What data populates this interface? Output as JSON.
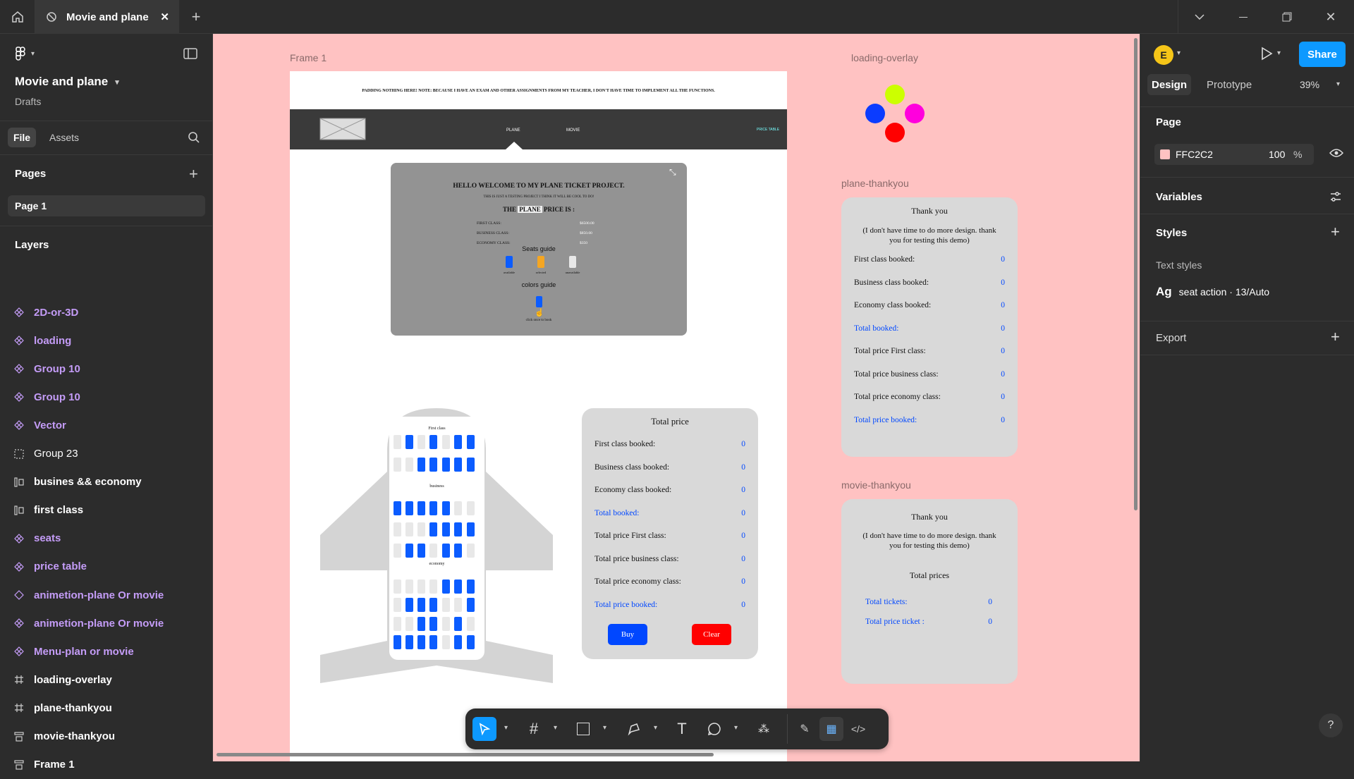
{
  "tab": {
    "title": "Movie and plane"
  },
  "file": {
    "name": "Movie and plane",
    "location": "Drafts",
    "tab_file": "File",
    "tab_assets": "Assets"
  },
  "pages": {
    "heading": "Pages",
    "items": [
      "Page 1"
    ]
  },
  "layers": {
    "heading": "Layers",
    "items": [
      {
        "label": "2D-or-3D",
        "icon": "component-icon",
        "style": "purple"
      },
      {
        "label": "loading",
        "icon": "component-icon",
        "style": "purple"
      },
      {
        "label": "Group 10",
        "icon": "component-icon",
        "style": "purple"
      },
      {
        "label": "Group 10",
        "icon": "component-icon",
        "style": "purple"
      },
      {
        "label": "Vector",
        "icon": "component-icon",
        "style": "purple"
      },
      {
        "label": "Group 23",
        "icon": "group-icon",
        "style": "normal"
      },
      {
        "label": "busines && economy",
        "icon": "autolayout-icon",
        "style": "white"
      },
      {
        "label": "first class",
        "icon": "autolayout-icon",
        "style": "white"
      },
      {
        "label": "seats",
        "icon": "component-icon",
        "style": "purple"
      },
      {
        "label": "price table",
        "icon": "component-icon",
        "style": "purple"
      },
      {
        "label": "animetion-plane Or movie",
        "icon": "component-outline-icon",
        "style": "purple-light"
      },
      {
        "label": "animetion-plane Or movie",
        "icon": "component-icon",
        "style": "purple"
      },
      {
        "label": "Menu-plan or movie",
        "icon": "component-icon",
        "style": "purple"
      },
      {
        "label": "loading-overlay",
        "icon": "frame-icon",
        "style": "white"
      },
      {
        "label": "plane-thankyou",
        "icon": "frame-icon",
        "style": "white"
      },
      {
        "label": "movie-thankyou",
        "icon": "autolayout-v-icon",
        "style": "white"
      },
      {
        "label": "Frame 1",
        "icon": "autolayout-v-icon",
        "style": "white"
      }
    ]
  },
  "canvas": {
    "bg": "#FFC2C2",
    "frame1_label": "Frame 1",
    "loading_label": "loading-overlay",
    "plane_thankyou_label": "plane-thankyou",
    "movie_thankyou_label": "movie-thankyou",
    "header_note": "PADDING NOTHING HERE! NOTE: BECAUSE I HAVE AN EXAM AND OTHER ASSIGNMENTS FROM MY TEACHER, I DON'T HAVE TIME TO IMPLEMENT ALL THE FUNCTIONS.",
    "nav": {
      "plane": "PLANE",
      "movie": "MOVIE",
      "price_table": "PRICE TABLE"
    },
    "welcome": {
      "title": "HELLO WELCOME TO MY PLANE TICKET PROJECT.",
      "sub": "THIS IS JUST A TESTING PROJECT I THINK IT WILL BE COOL TO DO!",
      "price_pre": "THE",
      "price_word": "PLANE",
      "price_post": "PRICE IS :",
      "prices": [
        {
          "label": "FIRST CLASS:",
          "value": "$6500.00"
        },
        {
          "label": "BUSINESS CLASS:",
          "value": "$850.00"
        },
        {
          "label": "ECONOMY CLASS:",
          "value": "$350"
        }
      ],
      "seats_guide": "Seats guide",
      "guide": [
        {
          "label": "available",
          "color": "#0b5cff"
        },
        {
          "label": "selected",
          "color": "#f5a623"
        },
        {
          "label": "unavailable",
          "color": "#e8e8e8"
        }
      ],
      "colors_guide": "colors guide",
      "click": "click once to book"
    },
    "plane": {
      "first": "First class",
      "business": "business",
      "economy": "economy"
    },
    "total": {
      "title": "Total price",
      "rows": [
        {
          "label": "First class booked:",
          "value": "0",
          "blue": false
        },
        {
          "label": "Business class booked:",
          "value": "0",
          "blue": false
        },
        {
          "label": "Economy class booked:",
          "value": "0",
          "blue": false
        },
        {
          "label": "Total booked:",
          "value": "0",
          "blue": true
        },
        {
          "label": "Total price First class:",
          "value": "0",
          "blue": false
        },
        {
          "label": "Total price business class:",
          "value": "0",
          "blue": false
        },
        {
          "label": "Total price economy class:",
          "value": "0",
          "blue": false
        },
        {
          "label": "Total price booked:",
          "value": "0",
          "blue": true
        }
      ],
      "buy": "Buy",
      "clear": "Clear"
    },
    "plane_thank": {
      "title": "Thank you",
      "note": "(I don't have time to do more design. thank you for testing this demo)"
    },
    "movie_thank": {
      "title": "Thank you",
      "note": "(I don't have time to do more design. thank you for testing this demo)",
      "prices_title": "Total prices",
      "rows": [
        {
          "label": "Total tickets:",
          "value": "0"
        },
        {
          "label": "Total price ticket :",
          "value": "0"
        }
      ]
    }
  },
  "right": {
    "avatar": "E",
    "share": "Share",
    "tab_design": "Design",
    "tab_prototype": "Prototype",
    "zoom": "39%",
    "page_heading": "Page",
    "page_color": "FFC2C2",
    "page_opacity": "100",
    "pct": "%",
    "variables": "Variables",
    "styles": "Styles",
    "text_styles": "Text styles",
    "style_ag": "Ag",
    "style_name": "seat action · 13/Auto",
    "export": "Export",
    "help": "?"
  }
}
